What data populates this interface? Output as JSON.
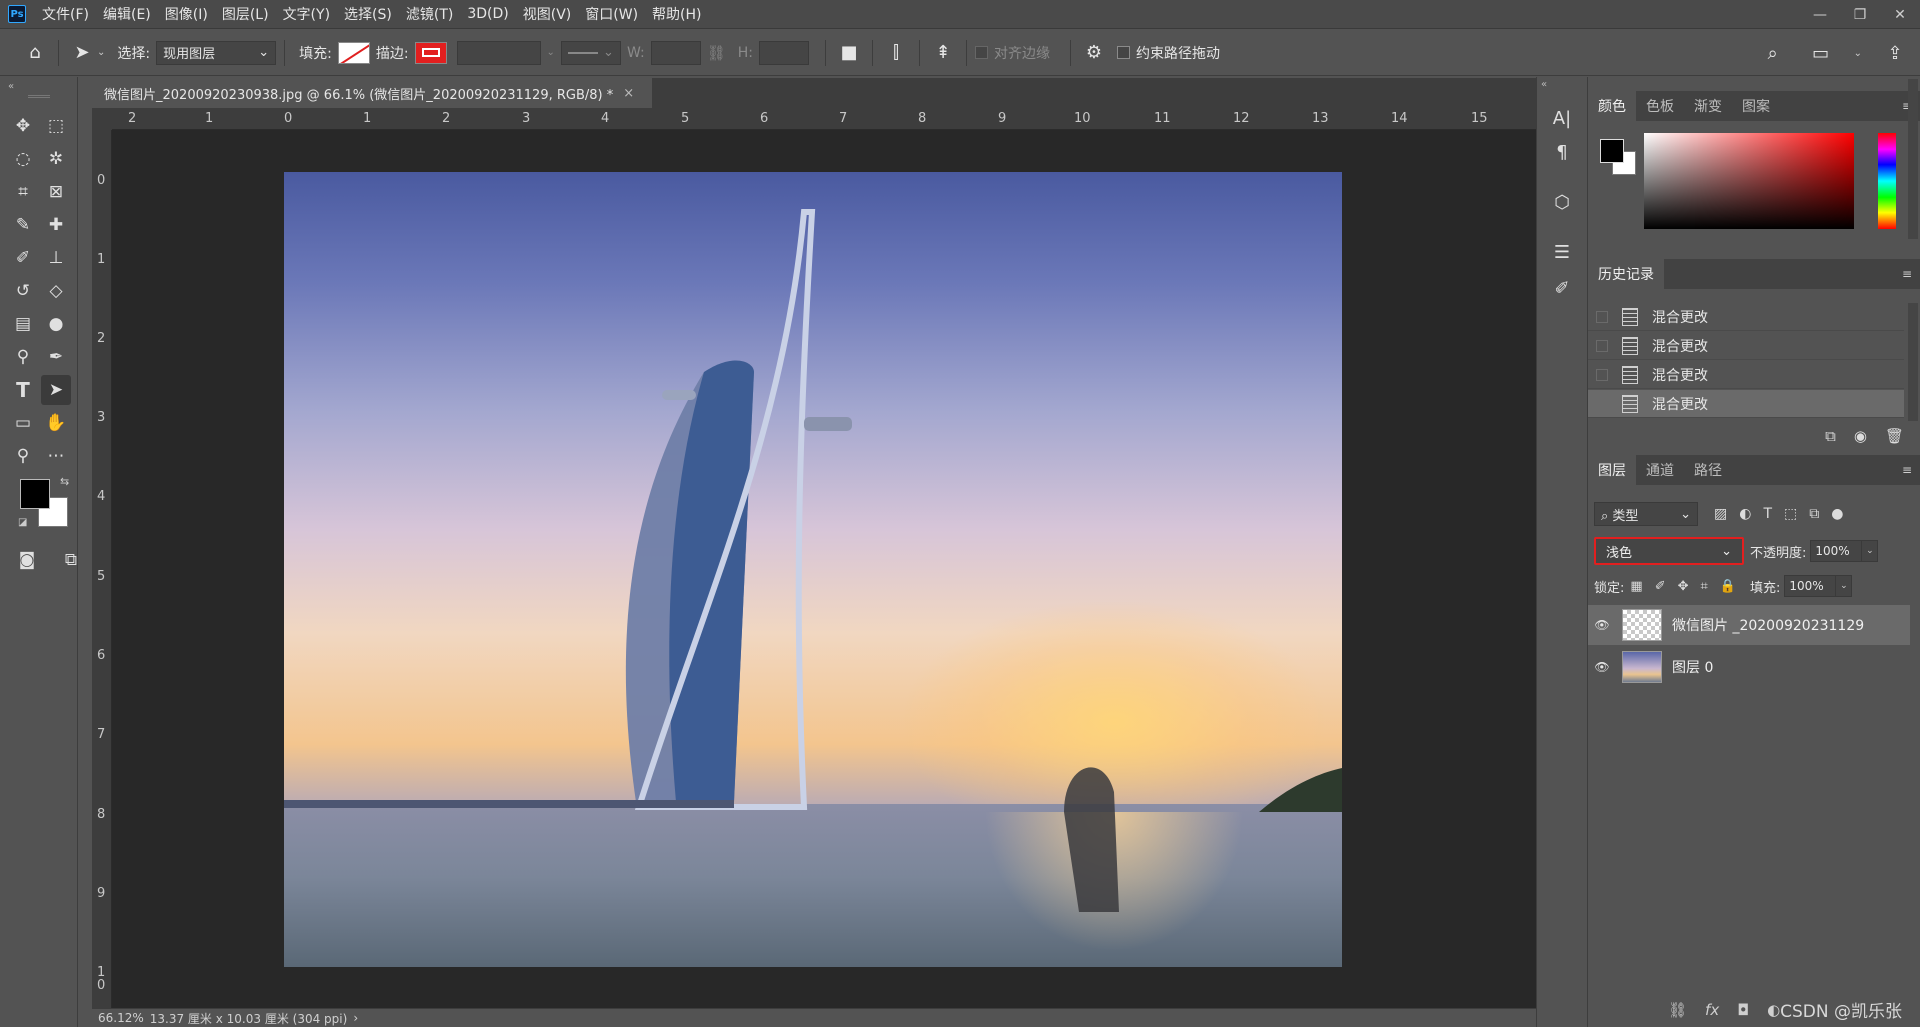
{
  "menubar": {
    "logo": "Ps",
    "items": [
      "文件(F)",
      "编辑(E)",
      "图像(I)",
      "图层(L)",
      "文字(Y)",
      "选择(S)",
      "滤镜(T)",
      "3D(D)",
      "视图(V)",
      "窗口(W)",
      "帮助(H)"
    ],
    "window_controls": [
      "—",
      "❐",
      "✕"
    ]
  },
  "options": {
    "select_label": "选择:",
    "select_value": "现用图层",
    "fill_label": "填充:",
    "stroke_label": "描边:",
    "w_label": "W:",
    "h_label": "H:",
    "align_edges_label": "对齐边缘",
    "constrain_path_label": "约束路径拖动"
  },
  "document": {
    "tab_title": "微信图片_20200920230938.jpg @ 66.1% (微信图片_20200920231129, RGB/8) *",
    "tab_close": "×",
    "ruler_top": [
      "2",
      "1",
      "0",
      "1",
      "2",
      "3",
      "4",
      "5",
      "6",
      "7",
      "8",
      "9",
      "10",
      "11",
      "12",
      "13",
      "14",
      "15"
    ],
    "ruler_left": [
      "0",
      "1",
      "2",
      "3",
      "4",
      "5",
      "6",
      "7",
      "8",
      "9",
      "1 0"
    ]
  },
  "statusbar": {
    "zoom": "66.12%",
    "doc_size": "13.37 厘米 x 10.03 厘米 (304 ppi)",
    "arrow": "›"
  },
  "panels": {
    "color_tabs": [
      "颜色",
      "色板",
      "渐变",
      "图案"
    ],
    "history_tabs": [
      "历史记录"
    ],
    "history_items": [
      "混合更改",
      "混合更改",
      "混合更改",
      "混合更改"
    ],
    "layers_tabs": [
      "图层",
      "通道",
      "路径"
    ],
    "kind_label": "类型",
    "blend_mode": "浅色",
    "opacity_label": "不透明度:",
    "opacity_value": "100%",
    "lock_label": "锁定:",
    "fill_label": "填充:",
    "fill_value": "100%",
    "layers": [
      {
        "name": "微信图片 _20200920231129"
      },
      {
        "name": "图层 0"
      }
    ],
    "menu_glyph": "≡"
  },
  "watermark": "CSDN @凯乐张",
  "colors": {
    "accent_red": "#e21f1f",
    "panel_bg": "#535353",
    "canvas_bg": "#282828"
  }
}
